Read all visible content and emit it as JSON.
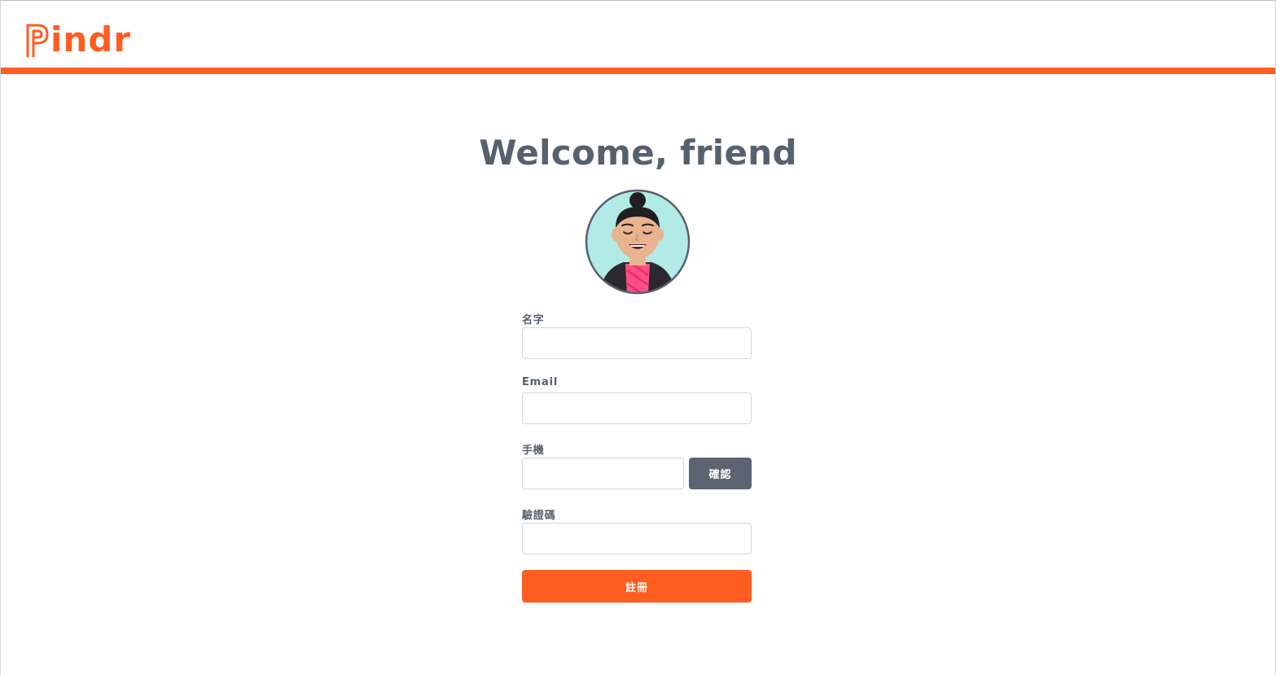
{
  "brand": {
    "logo_text": "indr",
    "logo_full": "Pindr",
    "accent_color": "#ff5d22"
  },
  "main": {
    "title": "Welcome, friend",
    "avatar": "avatar-illustration"
  },
  "form": {
    "name_label": "名字",
    "email_label": "Email",
    "phone_label": "手機",
    "confirm_label": "確認",
    "code_label": "驗證碼",
    "submit_label": "註冊",
    "name_value": "",
    "email_value": "",
    "phone_value": "",
    "code_value": ""
  },
  "colors": {
    "text": "#566170",
    "confirm_button": "#5b6470",
    "submit_button": "#ff5d22",
    "avatar_bg": "#b2ebe6"
  }
}
